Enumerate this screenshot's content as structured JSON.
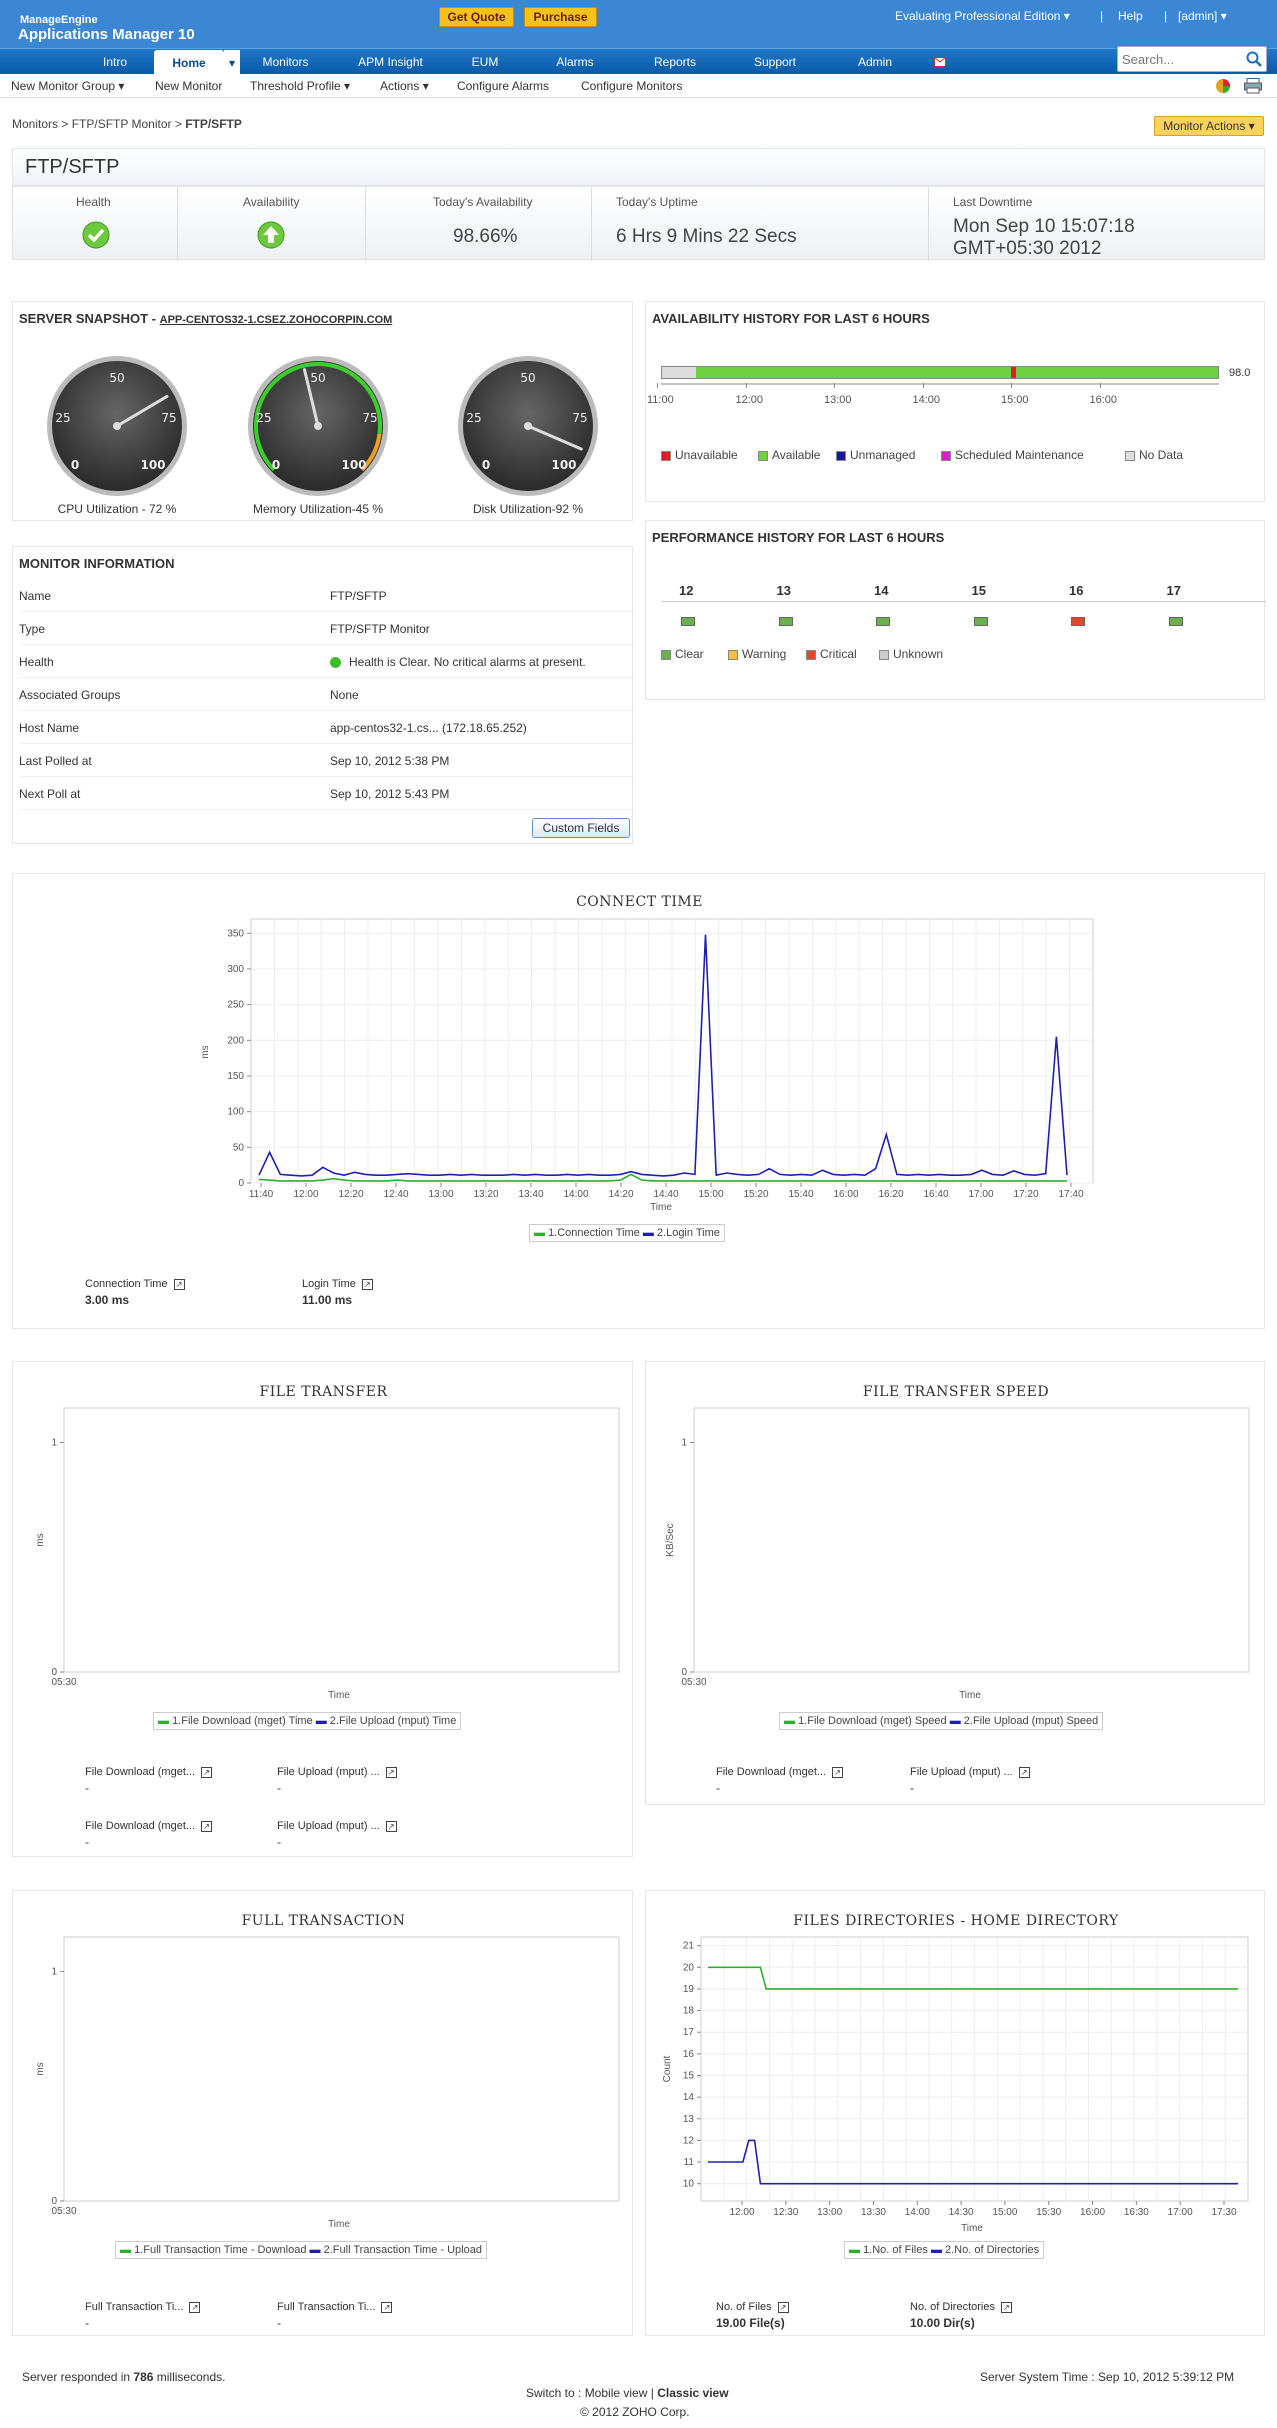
{
  "header": {
    "brand_line1": "ManageEngine",
    "brand_line2": "Applications Manager 10",
    "get_quote": "Get Quote",
    "purchase": "Purchase",
    "edition": "Evaluating Professional Edition",
    "help": "Help",
    "user": "[admin]"
  },
  "nav": {
    "items": [
      "Intro",
      "Home",
      "Monitors",
      "APM Insight",
      "EUM",
      "Alarms",
      "Reports",
      "Support",
      "Admin"
    ],
    "search_placeholder": "Search..."
  },
  "subnav": {
    "items": [
      "New Monitor Group",
      "New Monitor",
      "Threshold Profile",
      "Actions",
      "Configure Alarms",
      "Configure Monitors"
    ]
  },
  "breadcrumb": {
    "monitors": "Monitors",
    "sep1": " > ",
    "type": "FTP/SFTP Monitor",
    "sep2": " > ",
    "current": "FTP/SFTP"
  },
  "monitor_actions": "Monitor Actions",
  "title": "FTP/SFTP",
  "stats": {
    "health_label": "Health",
    "availability_label": "Availability",
    "today_avail_label": "Today's Availability",
    "today_avail": "98.66%",
    "uptime_label": "Today's Uptime",
    "uptime": "6 Hrs 9 Mins 22 Secs",
    "downtime_label": "Last Downtime",
    "downtime_1": "Mon Sep 10 15:07:18",
    "downtime_2": "GMT+05:30 2012"
  },
  "snapshot": {
    "title": "SERVER SNAPSHOT - ",
    "host": "APP-CENTOS32-1.CSEZ.ZOHOCORPIN.COM",
    "gauges": [
      {
        "label": "CPU Utilization - 72 %",
        "value": 72
      },
      {
        "label": "Memory Utilization-45 %",
        "value": 45
      },
      {
        "label": "Disk Utilization-92 %",
        "value": 92
      }
    ],
    "ticks": {
      "t0": "0",
      "t25": "25",
      "t50": "50",
      "t75": "75",
      "t100": "100"
    }
  },
  "avail": {
    "title": "AVAILABILITY HISTORY FOR LAST 6 HOURS",
    "value": "98.0",
    "times": [
      "11:00",
      "12:00",
      "13:00",
      "14:00",
      "15:00",
      "16:00"
    ],
    "legend": [
      "Unavailable",
      "Available",
      "Unmanaged",
      "Scheduled Maintenance",
      "No Data"
    ],
    "colors": [
      "#e02020",
      "#6ed13e",
      "#1a1a8c",
      "#d020d0",
      "#dddddd"
    ]
  },
  "perf": {
    "title": "PERFORMANCE HISTORY FOR LAST 6 HOURS",
    "hours": [
      "12",
      "13",
      "14",
      "15",
      "16",
      "17"
    ],
    "status_colors": [
      "#6ab04c",
      "#6ab04c",
      "#6ab04c",
      "#6ab04c",
      "#e0482a",
      "#6ab04c"
    ],
    "legend": [
      "Clear",
      "Warning",
      "Critical",
      "Unknown"
    ],
    "legend_colors": [
      "#6ab04c",
      "#f0c040",
      "#e0482a",
      "#cccccc"
    ]
  },
  "info": {
    "title": "MONITOR INFORMATION",
    "rows": [
      {
        "k": "Name",
        "v": "FTP/SFTP"
      },
      {
        "k": "Type",
        "v": "FTP/SFTP Monitor"
      },
      {
        "k": "Health",
        "v": "Health is Clear. No critical alarms at present."
      },
      {
        "k": "Associated Groups",
        "v": "None"
      },
      {
        "k": "Host Name",
        "v": "app-centos32-1.cs... (172.18.65.252)"
      },
      {
        "k": "Last Polled at",
        "v": "Sep 10, 2012 5:38 PM"
      },
      {
        "k": "Next Poll at",
        "v": "Sep 10, 2012 5:43 PM"
      }
    ],
    "custom_fields": "Custom Fields"
  },
  "connect": {
    "title": "CONNECT TIME",
    "ylabel": "ms",
    "xlabel": "Time",
    "legend": [
      "1.Connection Time",
      "2.Login Time"
    ],
    "m1_label": "Connection Time",
    "m1_val": "3.00 ms",
    "m2_label": "Login Time",
    "m2_val": "11.00 ms"
  },
  "file_transfer": {
    "title": "FILE TRANSFER",
    "ylabel": "ms",
    "xlabel": "Time",
    "x0": "05:30",
    "y0": "0",
    "y1": "1",
    "legend": [
      "1.File Download (mget) Time",
      "2.File Upload (mput) Time"
    ],
    "metrics": [
      {
        "label": "File Download (mget...",
        "val": "-"
      },
      {
        "label": "File Upload (mput) ...",
        "val": "-"
      },
      {
        "label": "File Download (mget...",
        "val": "-"
      },
      {
        "label": "File Upload (mput) ...",
        "val": "-"
      }
    ]
  },
  "file_speed": {
    "title": "FILE TRANSFER SPEED",
    "ylabel": "KB/Sec",
    "xlabel": "Time",
    "x0": "05:30",
    "y0": "0",
    "y1": "1",
    "legend": [
      "1.File Download (mget) Speed",
      "2.File Upload (mput) Speed"
    ],
    "metrics": [
      {
        "label": "File Download (mget...",
        "val": "-"
      },
      {
        "label": "File Upload (mput) ...",
        "val": "-"
      }
    ]
  },
  "full_tx": {
    "title": "FULL TRANSACTION",
    "ylabel": "ms",
    "xlabel": "Time",
    "x0": "05:30",
    "y0": "0",
    "y1": "1",
    "legend": [
      "1.Full Transaction Time - Download",
      "2.Full Transaction Time - Upload"
    ],
    "metrics": [
      {
        "label": "Full Transaction Ti...",
        "val": "-"
      },
      {
        "label": "Full Transaction Ti...",
        "val": "-"
      }
    ]
  },
  "files_dir": {
    "title": "FILES DIRECTORIES - HOME DIRECTORY",
    "ylabel": "Count",
    "xlabel": "Time",
    "legend": [
      "1.No. of Files",
      "2.No. of Directories"
    ],
    "m1_label": "No. of Files",
    "m1_val": "19.00 File(s)",
    "m2_label": "No. of Directories",
    "m2_val": "10.00 Dir(s)"
  },
  "footer": {
    "resp_pre": "Server responded in ",
    "resp_ms": "786",
    "resp_post": " milliseconds.",
    "switch_pre": "Switch to : ",
    "mobile": "Mobile view",
    "sep": " | ",
    "classic": "Classic view",
    "systime": "Server System Time : Sep 10, 2012 5:39:12 PM",
    "copyright": "© 2012 ZOHO Corp."
  },
  "chart_data": [
    {
      "type": "line",
      "title": "CONNECT TIME",
      "xlabel": "Time",
      "ylabel": "ms",
      "ylim": [
        0,
        350
      ],
      "yticks": [
        0,
        50,
        100,
        150,
        200,
        250,
        300,
        350
      ],
      "xticks": [
        "11:40",
        "12:00",
        "12:20",
        "12:40",
        "13:00",
        "13:20",
        "13:40",
        "14:00",
        "14:20",
        "14:40",
        "15:00",
        "15:20",
        "15:40",
        "16:00",
        "16:20",
        "16:40",
        "17:00",
        "17:20",
        "17:40"
      ],
      "x": [
        0,
        1,
        2,
        3,
        4,
        5,
        6,
        7,
        8,
        9,
        10,
        11,
        12,
        13,
        14,
        15,
        16,
        17,
        18,
        19,
        20,
        21,
        22,
        23,
        24,
        25,
        26,
        27,
        28,
        29,
        30,
        31,
        32,
        33,
        34,
        35,
        36,
        37,
        38,
        39,
        40,
        41,
        42,
        43,
        44,
        45,
        46,
        47,
        48,
        49,
        50,
        51,
        52,
        53,
        54,
        55,
        56,
        57,
        58,
        59,
        60,
        61,
        62,
        63,
        64,
        65,
        66,
        67,
        68,
        69,
        70,
        71,
        72,
        73,
        74,
        75,
        76
      ],
      "series": [
        {
          "name": "1.Connection Time",
          "color": "#2db12d",
          "values": [
            5,
            4,
            3,
            3,
            3,
            3,
            4,
            6,
            4,
            3,
            3,
            3,
            3,
            4,
            3,
            3,
            3,
            3,
            3,
            3,
            3,
            3,
            3,
            3,
            3,
            3,
            3,
            3,
            3,
            3,
            3,
            3,
            3,
            3,
            4,
            12,
            4,
            3,
            3,
            3,
            3,
            3,
            3,
            3,
            3,
            3,
            3,
            3,
            3,
            3,
            3,
            3,
            3,
            3,
            3,
            3,
            3,
            3,
            3,
            3,
            3,
            3,
            3,
            3,
            3,
            3,
            3,
            3,
            3,
            3,
            3,
            3,
            3,
            3,
            3,
            3,
            3
          ]
        },
        {
          "name": "2.Login Time",
          "color": "#2020b0",
          "values": [
            11,
            43,
            12,
            11,
            10,
            11,
            22,
            14,
            11,
            15,
            12,
            11,
            11,
            12,
            13,
            12,
            11,
            11,
            12,
            11,
            12,
            11,
            11,
            11,
            12,
            11,
            12,
            11,
            11,
            12,
            11,
            12,
            11,
            11,
            12,
            16,
            12,
            11,
            10,
            11,
            14,
            12,
            348,
            11,
            14,
            12,
            11,
            12,
            20,
            12,
            11,
            12,
            11,
            18,
            12,
            11,
            12,
            11,
            20,
            68,
            12,
            11,
            12,
            11,
            12,
            11,
            11,
            12,
            18,
            12,
            11,
            17,
            12,
            11,
            13,
            205,
            11
          ]
        }
      ]
    },
    {
      "type": "line",
      "title": "FILE TRANSFER",
      "xlabel": "Time",
      "ylabel": "ms",
      "ylim": [
        0,
        1
      ],
      "series": [
        {
          "name": "1.File Download (mget) Time",
          "values": []
        },
        {
          "name": "2.File Upload (mput) Time",
          "values": []
        }
      ]
    },
    {
      "type": "line",
      "title": "FILE TRANSFER SPEED",
      "xlabel": "Time",
      "ylabel": "KB/Sec",
      "ylim": [
        0,
        1
      ],
      "series": [
        {
          "name": "1.File Download (mget) Speed",
          "values": []
        },
        {
          "name": "2.File Upload (mput) Speed",
          "values": []
        }
      ]
    },
    {
      "type": "line",
      "title": "FULL TRANSACTION",
      "xlabel": "Time",
      "ylabel": "ms",
      "ylim": [
        0,
        1
      ],
      "series": [
        {
          "name": "1.Full Transaction Time - Download",
          "values": []
        },
        {
          "name": "2.Full Transaction Time - Upload",
          "values": []
        }
      ]
    },
    {
      "type": "line",
      "title": "FILES DIRECTORIES - HOME DIRECTORY",
      "xlabel": "Time",
      "ylabel": "Count",
      "ylim": [
        10,
        21
      ],
      "yticks": [
        10,
        11,
        12,
        13,
        14,
        15,
        16,
        17,
        18,
        19,
        20,
        21
      ],
      "xticks": [
        "12:00",
        "12:30",
        "13:00",
        "13:30",
        "14:00",
        "14:30",
        "15:00",
        "15:30",
        "16:00",
        "16:30",
        "17:00",
        "17:30"
      ],
      "x": [
        0,
        1,
        2,
        3,
        4,
        5,
        6,
        7,
        8,
        9,
        10,
        11,
        12,
        13,
        14,
        15,
        16,
        17,
        18,
        19,
        20,
        21,
        22,
        23,
        24,
        25,
        26,
        27,
        28,
        29,
        30,
        31,
        32,
        33,
        34,
        35,
        36,
        37,
        38,
        39,
        40,
        41,
        42,
        43,
        44,
        45,
        46,
        47,
        48,
        49,
        50,
        51,
        52,
        53,
        54,
        55,
        56,
        57,
        58,
        59,
        60,
        61,
        62,
        63,
        64,
        65,
        66,
        67,
        68,
        69,
        70,
        71,
        72,
        73,
        74,
        75,
        76,
        77,
        78,
        79,
        80,
        81,
        82,
        83,
        84,
        85,
        86,
        87,
        88,
        89,
        90,
        91
      ],
      "series": [
        {
          "name": "1.No. of Files",
          "color": "#2db12d",
          "values": [
            20,
            20,
            20,
            20,
            20,
            20,
            20,
            20,
            20,
            20,
            19,
            19,
            19,
            19,
            19,
            19,
            19,
            19,
            19,
            19,
            19,
            19,
            19,
            19,
            19,
            19,
            19,
            19,
            19,
            19,
            19,
            19,
            19,
            19,
            19,
            19,
            19,
            19,
            19,
            19,
            19,
            19,
            19,
            19,
            19,
            19,
            19,
            19,
            19,
            19,
            19,
            19,
            19,
            19,
            19,
            19,
            19,
            19,
            19,
            19,
            19,
            19,
            19,
            19,
            19,
            19,
            19,
            19,
            19,
            19,
            19,
            19,
            19,
            19,
            19,
            19,
            19,
            19,
            19,
            19,
            19,
            19,
            19,
            19,
            19,
            19,
            19,
            19,
            19,
            19,
            19,
            19
          ]
        },
        {
          "name": "2.No. of Directories",
          "color": "#2020b0",
          "values": [
            11,
            11,
            11,
            11,
            11,
            11,
            11,
            12,
            12,
            10,
            10,
            10,
            10,
            10,
            10,
            10,
            10,
            10,
            10,
            10,
            10,
            10,
            10,
            10,
            10,
            10,
            10,
            10,
            10,
            10,
            10,
            10,
            10,
            10,
            10,
            10,
            10,
            10,
            10,
            10,
            10,
            10,
            10,
            10,
            10,
            10,
            10,
            10,
            10,
            10,
            10,
            10,
            10,
            10,
            10,
            10,
            10,
            10,
            10,
            10,
            10,
            10,
            10,
            10,
            10,
            10,
            10,
            10,
            10,
            10,
            10,
            10,
            10,
            10,
            10,
            10,
            10,
            10,
            10,
            10,
            10,
            10,
            10,
            10,
            10,
            10,
            10,
            10,
            10,
            10,
            10,
            10
          ]
        }
      ]
    }
  ]
}
